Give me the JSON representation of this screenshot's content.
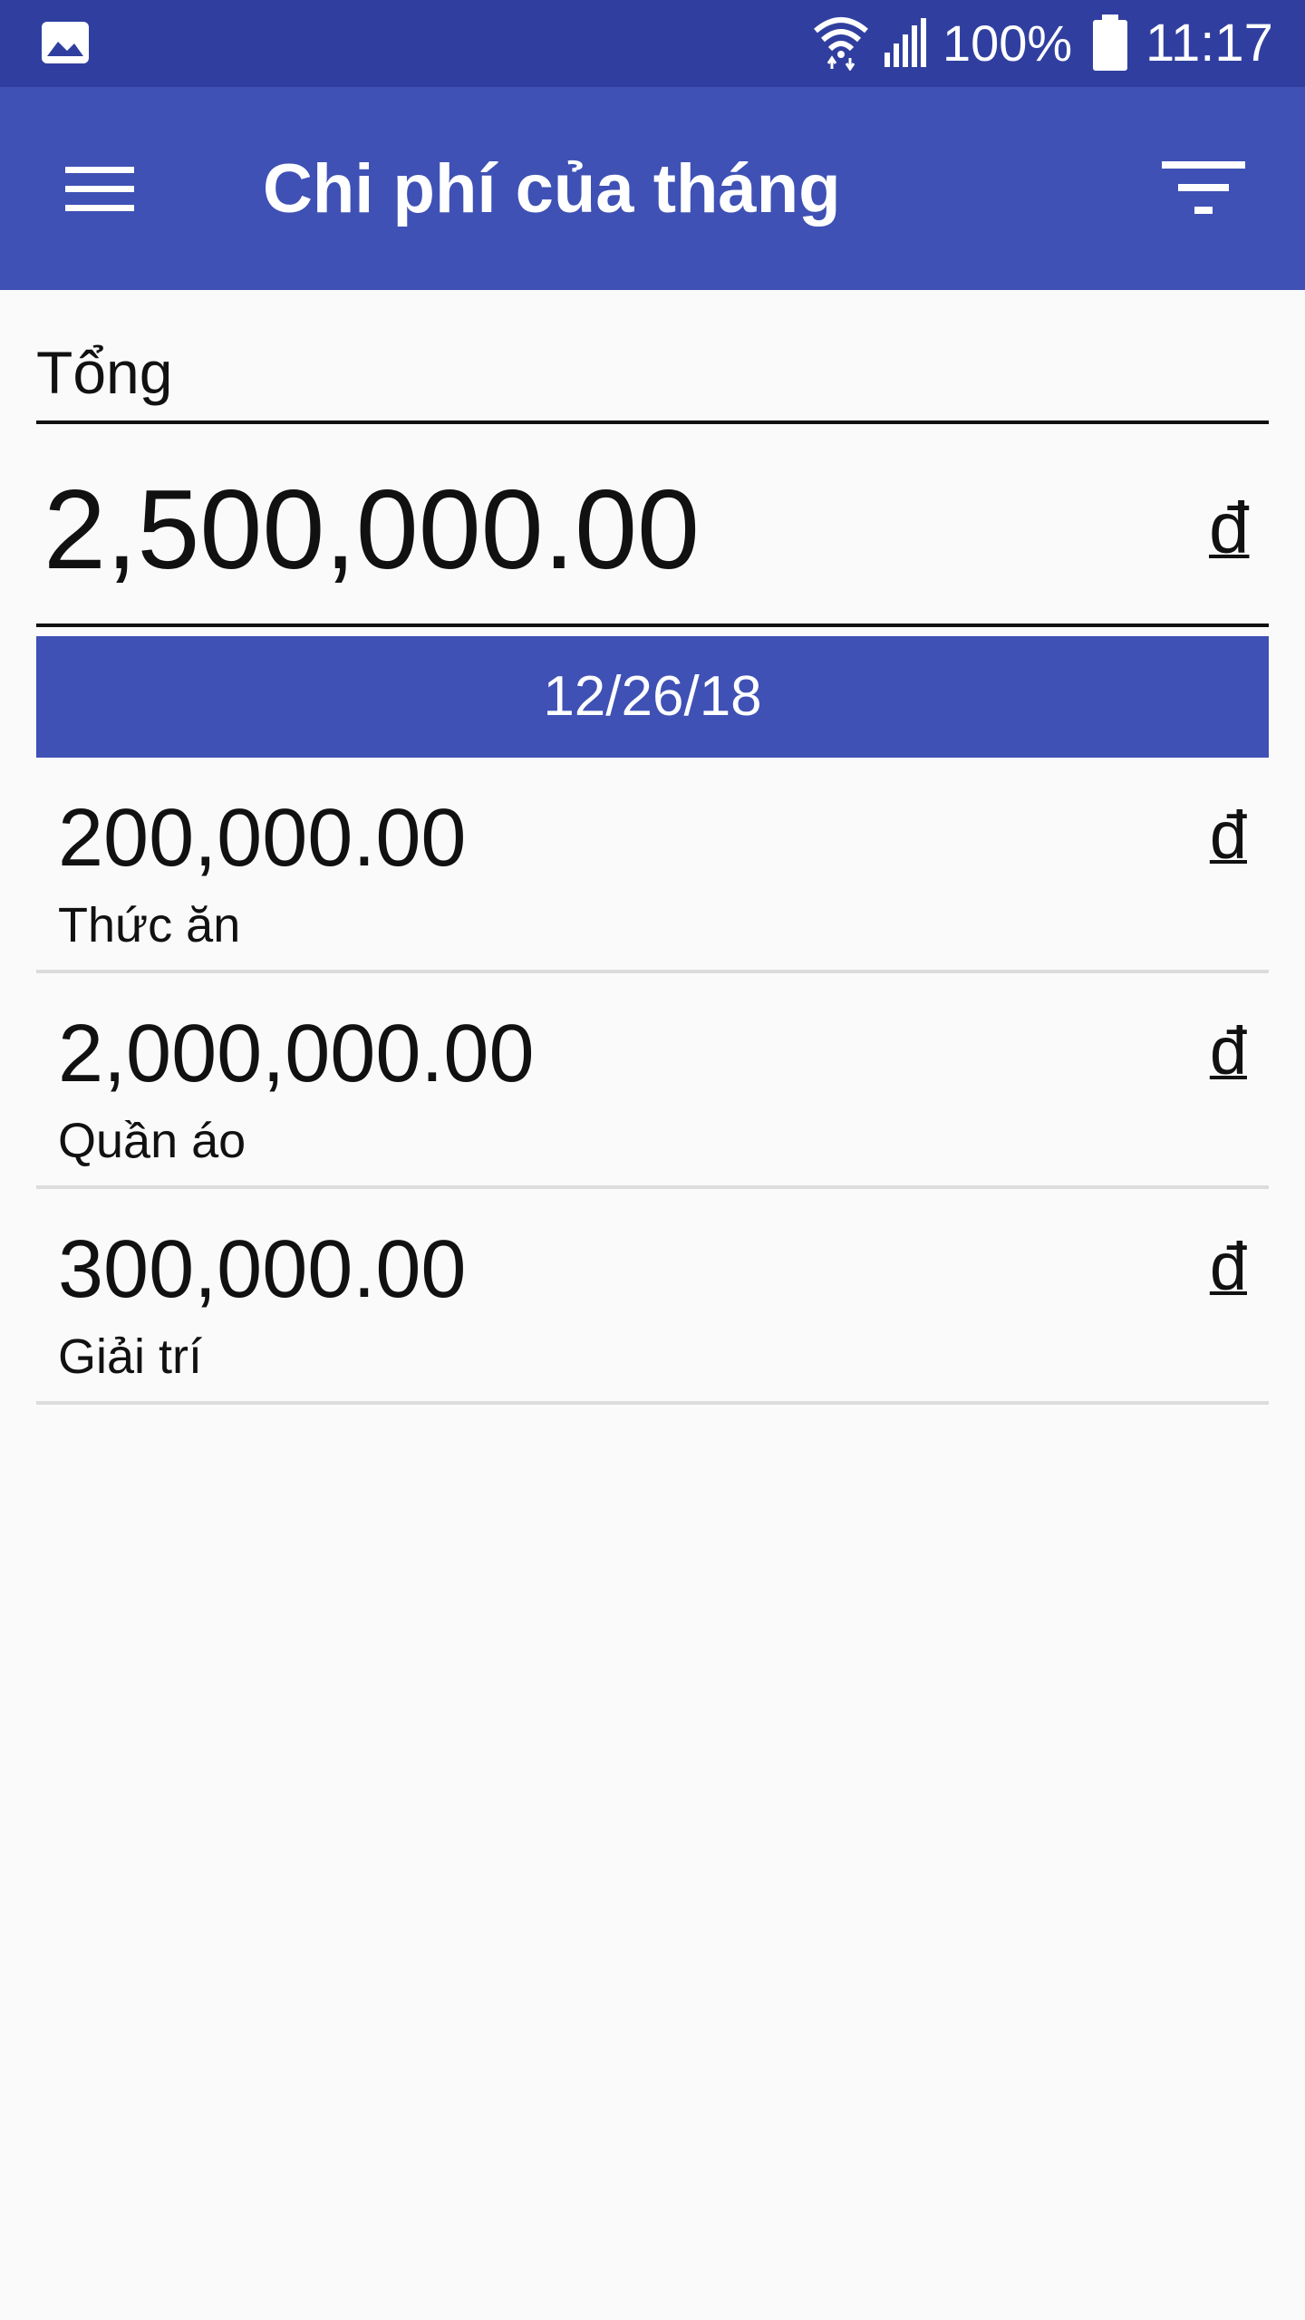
{
  "status_bar": {
    "battery": "100%",
    "time": "11:17",
    "icons": [
      "gallery-icon",
      "wifi-icon",
      "signal-icon",
      "battery-icon"
    ]
  },
  "app_bar": {
    "title": "Chi phí của tháng",
    "icons": [
      "menu-icon",
      "filter-icon"
    ],
    "color": "#3f51b5"
  },
  "summary": {
    "label": "Tổng",
    "amount": "2,500,000.00",
    "currency": "đ"
  },
  "date_header": "12/26/18",
  "expenses": [
    {
      "amount": "200,000.00",
      "category": "Thức ăn",
      "currency": "đ"
    },
    {
      "amount": "2,000,000.00",
      "category": "Quần áo",
      "currency": "đ"
    },
    {
      "amount": "300,000.00",
      "category": "Giải trí",
      "currency": "đ"
    }
  ]
}
